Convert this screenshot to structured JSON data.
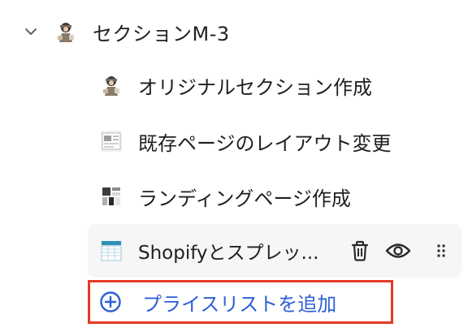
{
  "section": {
    "title": "セクションM-3",
    "expanded": true
  },
  "items": [
    {
      "label": "オリジナルセクション作成",
      "icon": "character-thumbnail-icon"
    },
    {
      "label": "既存ページのレイアウト変更",
      "icon": "layout-thumbnail-icon"
    },
    {
      "label": "ランディングページ作成",
      "icon": "landing-thumbnail-icon"
    }
  ],
  "selected_item": {
    "label": "Shopifyとスプレッ...",
    "icon": "spreadsheet-thumbnail-icon",
    "actions": [
      "trash-icon",
      "eye-icon",
      "drag-handle-icon"
    ]
  },
  "add_button": {
    "label": "プライスリストを追加",
    "icon": "plus-circle-icon"
  },
  "colors": {
    "highlight_border": "#e53a27",
    "link_blue": "#2b5fd6",
    "selected_bg": "#f6f6f7"
  }
}
